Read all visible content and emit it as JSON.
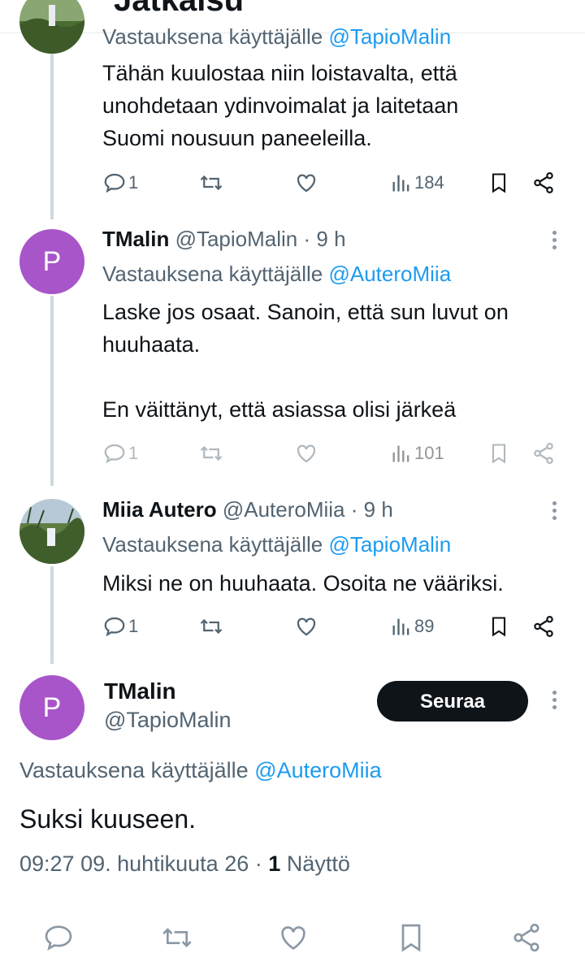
{
  "header": {
    "title": "Jatkaisu"
  },
  "thread": [
    {
      "reply_prefix": "Vastauksena käyttäjälle",
      "reply_to": "@TapioMalin",
      "lines": [
        "Tähän kuulostaa niin loistavalta, että",
        "unohdetaan ydinvoimalat ja laitetaan",
        "Suomi nousuun paneeleilla."
      ],
      "replies": "1",
      "views": "184"
    },
    {
      "name": "TMalin",
      "handle": "@TapioMalin",
      "sep": "·",
      "time": "9 h",
      "avatar_letter": "P",
      "reply_prefix": "Vastauksena käyttäjälle",
      "reply_to": "@AuteroMiia",
      "lines": [
        "Laske jos osaat. Sanoin, että sun luvut on",
        "huuhaata.",
        "",
        "En väittänyt, että asiassa olisi järkeä"
      ],
      "replies": "1",
      "views": "101"
    },
    {
      "name": "Miia Autero",
      "handle": "@AuteroMiia",
      "sep": "·",
      "time": "9 h",
      "reply_prefix": "Vastauksena käyttäjälle",
      "reply_to": "@TapioMalin",
      "lines": [
        "Miksi ne on huuhaata. Osoita ne vääriksi."
      ],
      "replies": "1",
      "views": "89"
    }
  ],
  "main": {
    "name": "TMalin",
    "handle": "@TapioMalin",
    "avatar_letter": "P",
    "follow_label": "Seuraa",
    "reply_prefix": "Vastauksena käyttäjälle",
    "reply_to": "@AuteroMiia",
    "text": "Suksi kuuseen.",
    "timestamp": "09:27 09. huhtikuuta 26",
    "sep": "·",
    "views_count": "1",
    "views_label": "Näyttö"
  },
  "colors": {
    "accent": "#1d9bf0",
    "avatar": "#a855c9",
    "text": "#0f1419",
    "muted": "#536471"
  },
  "icons": [
    "back-arrow-icon",
    "reply-icon",
    "retweet-icon",
    "like-icon",
    "views-icon",
    "bookmark-icon",
    "share-icon",
    "more-icon"
  ]
}
